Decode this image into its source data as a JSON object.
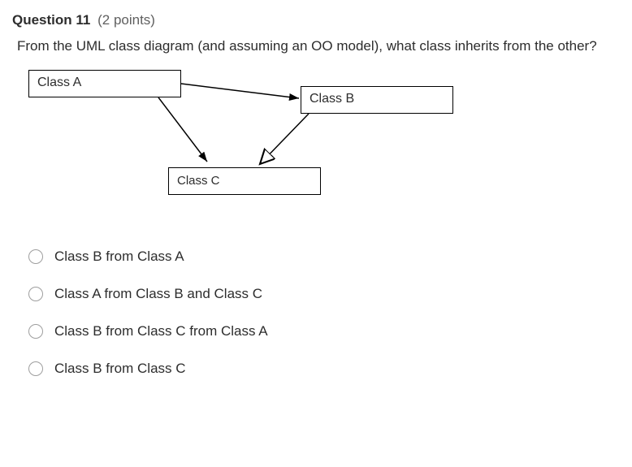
{
  "question": {
    "number_label": "Question 11",
    "points_label": "(2 points)",
    "prompt": "From the UML class diagram (and assuming an OO model), what class inherits from the other?"
  },
  "diagram": {
    "classA": "Class A",
    "classB": "Class B",
    "classC": "Class C"
  },
  "options": [
    {
      "label": "Class B from Class A"
    },
    {
      "label": "Class A from Class B and Class C"
    },
    {
      "label": "Class B from Class C from Class A"
    },
    {
      "label": "Class B from Class C"
    }
  ]
}
